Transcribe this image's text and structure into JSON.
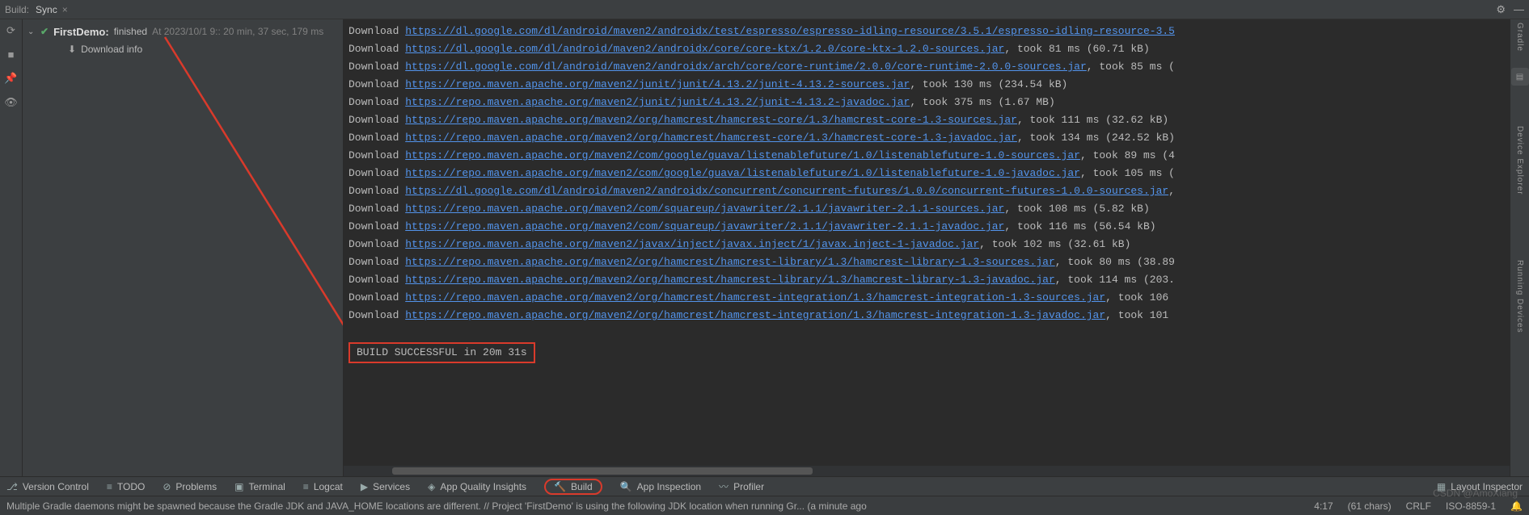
{
  "header": {
    "build_label": "Build:",
    "tab_name": "Sync"
  },
  "tree": {
    "project_name": "FirstDemo:",
    "status": "finished",
    "meta": "At 2023/10/1 9:: 20 min, 37 sec, 179 ms",
    "download_info": "Download info"
  },
  "console": {
    "lines": [
      {
        "prefix": "Download ",
        "url": "https://dl.google.com/dl/android/maven2/androidx/test/espresso/espresso-idling-resource/3.5.1/espresso-idling-resource-3.5",
        "suffix": ""
      },
      {
        "prefix": "Download ",
        "url": "https://dl.google.com/dl/android/maven2/androidx/core/core-ktx/1.2.0/core-ktx-1.2.0-sources.jar",
        "suffix": ", took 81 ms (60.71 kB)"
      },
      {
        "prefix": "Download ",
        "url": "https://dl.google.com/dl/android/maven2/androidx/arch/core/core-runtime/2.0.0/core-runtime-2.0.0-sources.jar",
        "suffix": ", took 85 ms ("
      },
      {
        "prefix": "Download ",
        "url": "https://repo.maven.apache.org/maven2/junit/junit/4.13.2/junit-4.13.2-sources.jar",
        "suffix": ", took 130 ms (234.54 kB)"
      },
      {
        "prefix": "Download ",
        "url": "https://repo.maven.apache.org/maven2/junit/junit/4.13.2/junit-4.13.2-javadoc.jar",
        "suffix": ", took 375 ms (1.67 MB)"
      },
      {
        "prefix": "Download ",
        "url": "https://repo.maven.apache.org/maven2/org/hamcrest/hamcrest-core/1.3/hamcrest-core-1.3-sources.jar",
        "suffix": ", took 111 ms (32.62 kB)"
      },
      {
        "prefix": "Download ",
        "url": "https://repo.maven.apache.org/maven2/org/hamcrest/hamcrest-core/1.3/hamcrest-core-1.3-javadoc.jar",
        "suffix": ", took 134 ms (242.52 kB)"
      },
      {
        "prefix": "Download ",
        "url": "https://repo.maven.apache.org/maven2/com/google/guava/listenablefuture/1.0/listenablefuture-1.0-sources.jar",
        "suffix": ", took 89 ms (4"
      },
      {
        "prefix": "Download ",
        "url": "https://repo.maven.apache.org/maven2/com/google/guava/listenablefuture/1.0/listenablefuture-1.0-javadoc.jar",
        "suffix": ", took 105 ms ("
      },
      {
        "prefix": "Download ",
        "url": "https://dl.google.com/dl/android/maven2/androidx/concurrent/concurrent-futures/1.0.0/concurrent-futures-1.0.0-sources.jar",
        "suffix": ","
      },
      {
        "prefix": "Download ",
        "url": "https://repo.maven.apache.org/maven2/com/squareup/javawriter/2.1.1/javawriter-2.1.1-sources.jar",
        "suffix": ", took 108 ms (5.82 kB)"
      },
      {
        "prefix": "Download ",
        "url": "https://repo.maven.apache.org/maven2/com/squareup/javawriter/2.1.1/javawriter-2.1.1-javadoc.jar",
        "suffix": ", took 116 ms (56.54 kB)"
      },
      {
        "prefix": "Download ",
        "url": "https://repo.maven.apache.org/maven2/javax/inject/javax.inject/1/javax.inject-1-javadoc.jar",
        "suffix": ", took 102 ms (32.61 kB)"
      },
      {
        "prefix": "Download ",
        "url": "https://repo.maven.apache.org/maven2/org/hamcrest/hamcrest-library/1.3/hamcrest-library-1.3-sources.jar",
        "suffix": ", took 80 ms (38.89"
      },
      {
        "prefix": "Download ",
        "url": "https://repo.maven.apache.org/maven2/org/hamcrest/hamcrest-library/1.3/hamcrest-library-1.3-javadoc.jar",
        "suffix": ", took 114 ms (203."
      },
      {
        "prefix": "Download ",
        "url": "https://repo.maven.apache.org/maven2/org/hamcrest/hamcrest-integration/1.3/hamcrest-integration-1.3-sources.jar",
        "suffix": ", took 106 "
      },
      {
        "prefix": "Download ",
        "url": "https://repo.maven.apache.org/maven2/org/hamcrest/hamcrest-integration/1.3/hamcrest-integration-1.3-javadoc.jar",
        "suffix": ", took 101 "
      }
    ],
    "success": "BUILD SUCCESSFUL in 20m 31s"
  },
  "right_gutter": {
    "gradle": "Gradle",
    "device_explorer": "Device Explorer",
    "running_devices": "Running Devices"
  },
  "bottom_tools": {
    "version_control": "Version Control",
    "todo": "TODO",
    "problems": "Problems",
    "terminal": "Terminal",
    "logcat": "Logcat",
    "services": "Services",
    "app_quality": "App Quality Insights",
    "build": "Build",
    "app_inspection": "App Inspection",
    "profiler": "Profiler",
    "layout_inspector": "Layout Inspector"
  },
  "status": {
    "message": "Multiple Gradle daemons might be spawned because the Gradle JDK and JAVA_HOME locations are different. // Project 'FirstDemo' is using the following JDK location when running Gr... (a minute ago",
    "caret": "4:17",
    "chars": "(61 chars)",
    "line_ending": "CRLF",
    "encoding": "ISO-8859-1"
  },
  "watermark": "CSDN @AmoXiang"
}
